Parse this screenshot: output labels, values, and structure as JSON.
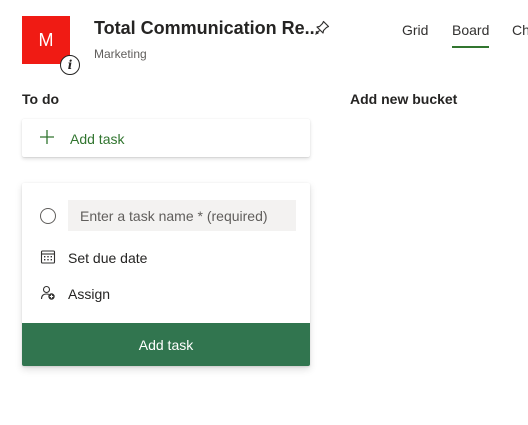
{
  "header": {
    "avatar_letter": "M",
    "plan_title": "Total Communication Re...",
    "group": "Marketing",
    "tabs": [
      {
        "label": "Grid",
        "active": false
      },
      {
        "label": "Board",
        "active": true
      },
      {
        "label": "Ch",
        "active": false
      }
    ]
  },
  "buckets": {
    "todo_title": "To do",
    "add_bucket_label": "Add new bucket"
  },
  "add_task_row": {
    "label": "Add task"
  },
  "new_task_form": {
    "name_placeholder": "Enter a task name * (required)",
    "name_value": "",
    "due_date_label": "Set due date",
    "assign_label": "Assign",
    "submit_label": "Add task"
  },
  "colors": {
    "avatar_bg": "#f01b14",
    "accent": "#31752f",
    "submit_bg": "#31754f"
  },
  "icons": [
    "info-icon",
    "pin-icon",
    "plus-icon",
    "radio-circle-icon",
    "calendar-icon",
    "person-add-icon"
  ]
}
